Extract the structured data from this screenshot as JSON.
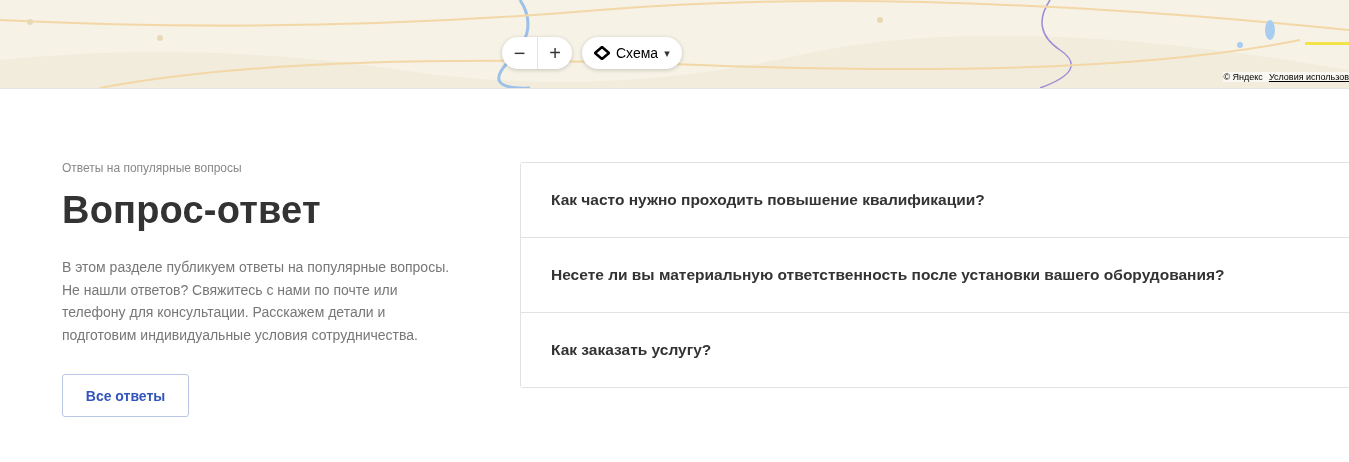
{
  "map": {
    "kind": "picture",
    "zoom_out": "−",
    "zoom_in": "+",
    "layer_button": {
      "label": "Схема",
      "caret": "▾"
    },
    "copyright": "© Яндекс",
    "terms_link": "Условия использов"
  },
  "faq": {
    "eyebrow": "Ответы на популярные вопросы",
    "title": "Вопрос-ответ",
    "description": "В этом разделе публикуем ответы на популярные вопросы. Не нашли ответов? Свяжитесь с нами по почте или телефону для консультации. Расскажем детали и подготовим индивидуальные условия сотрудничества.",
    "button": "Все ответы",
    "questions": [
      {
        "text": "Как часто нужно проходить повышение квалификации?"
      },
      {
        "text": "Несете ли вы материальную ответственность после установки вашего оборудования?"
      },
      {
        "text": "Как заказать услугу?"
      }
    ]
  }
}
